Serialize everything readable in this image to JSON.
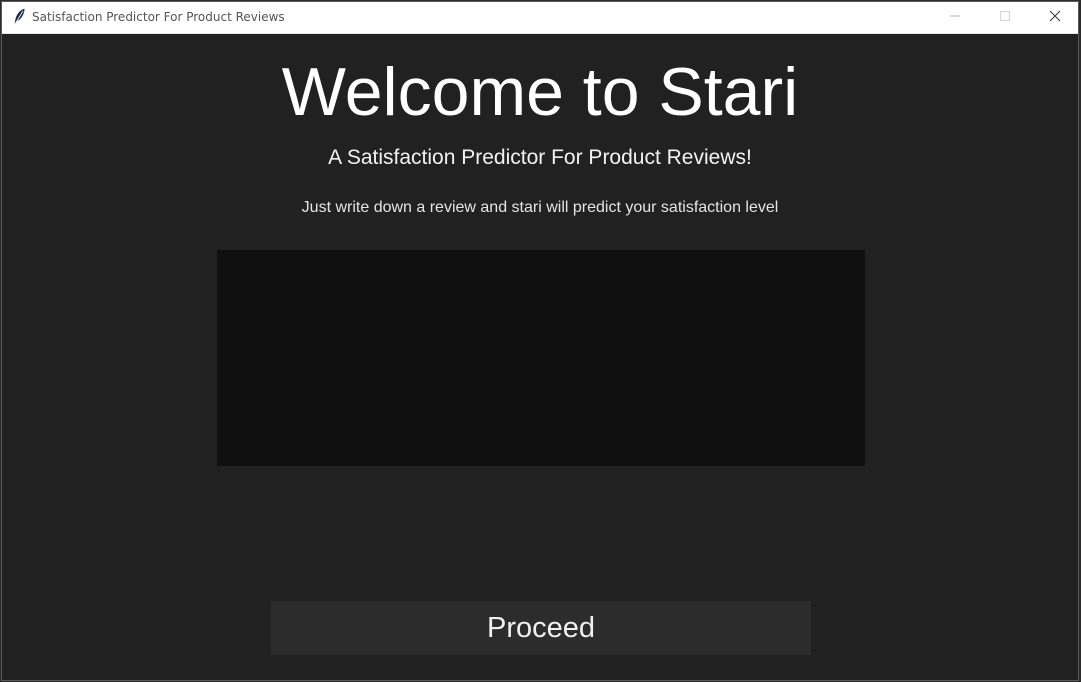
{
  "window": {
    "title": "Satisfaction Predictor For Product Reviews",
    "icon": "feather-icon"
  },
  "main": {
    "heading": "Welcome to Stari",
    "subtitle": "A Satisfaction Predictor For Product Reviews!",
    "instruction": "Just write down a review and stari will predict your satisfaction level",
    "review_value": "",
    "proceed_label": "Proceed"
  },
  "colors": {
    "background": "#212121",
    "input_background": "#101010",
    "button_background": "#2c2c2c",
    "text": "#ffffff"
  }
}
